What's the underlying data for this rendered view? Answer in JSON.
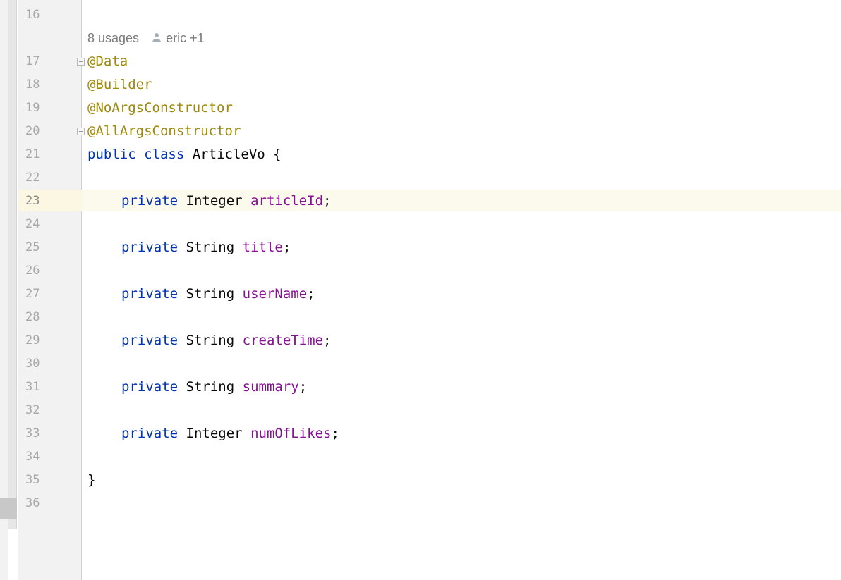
{
  "gutter": {
    "line_numbers": [
      "16",
      "17",
      "18",
      "19",
      "20",
      "21",
      "22",
      "23",
      "24",
      "25",
      "26",
      "27",
      "28",
      "29",
      "30",
      "31",
      "32",
      "33",
      "34",
      "35",
      "36"
    ],
    "current_line": "23"
  },
  "inlay_hint": {
    "usages": "8 usages",
    "authors": "eric +1",
    "author_icon": "user-icon"
  },
  "code": {
    "ann_data": "@Data",
    "ann_builder": "@Builder",
    "ann_noargs": "@NoArgsConstructor",
    "ann_allargs": "@AllArgsConstructor",
    "kw_public": "public",
    "kw_class": "class",
    "class_decl": "ArticleVo {",
    "kw_private": "private",
    "type_integer": "Integer",
    "type_string": "String",
    "field_articleId": "articleId",
    "field_title": "title",
    "field_userName": "userName",
    "field_createTime": "createTime",
    "field_summary": "summary",
    "field_numOfLikes": "numOfLikes",
    "semicolon": ";",
    "close_brace": "}"
  },
  "colors": {
    "keyword": "#0033b3",
    "annotation": "#9e880d",
    "field": "#871094",
    "line_number": "#a8a8a8",
    "current_line_bg": "#fcfaed"
  }
}
